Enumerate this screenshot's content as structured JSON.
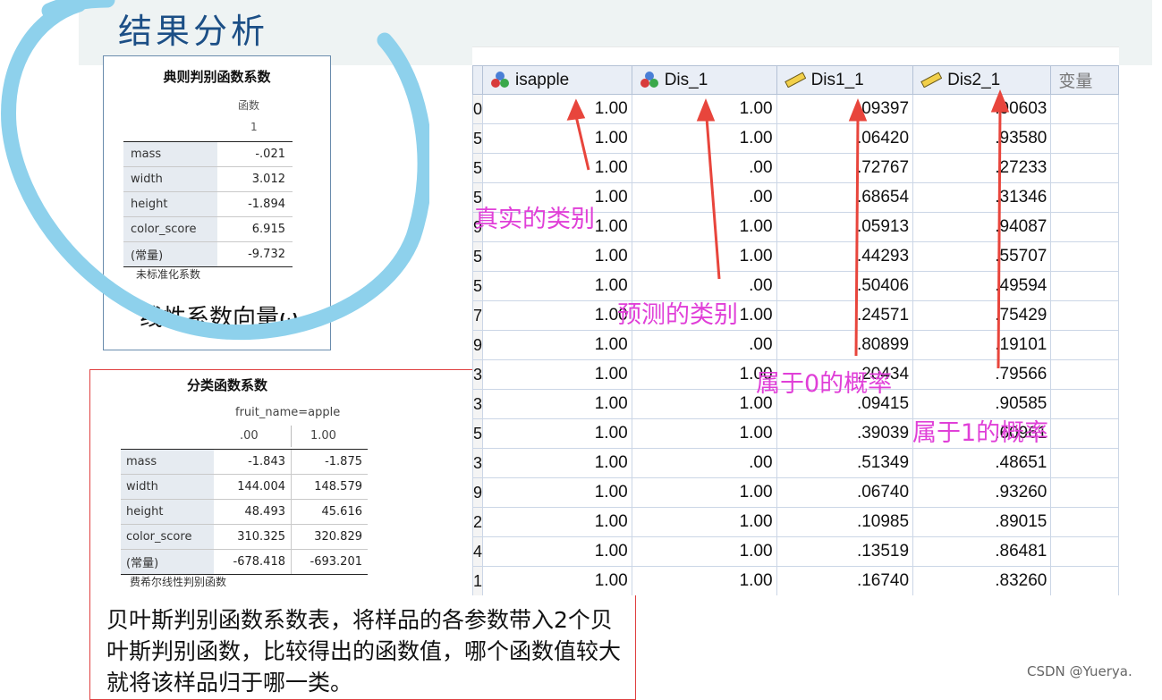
{
  "slide": {
    "title": "结果分析",
    "watermark": "CSDN @Yuerya."
  },
  "canonical": {
    "title": "典则判别函数系数",
    "header1": "函数",
    "header2": "1",
    "rows": [
      {
        "label": "mass",
        "value": "-.021"
      },
      {
        "label": "width",
        "value": "3.012"
      },
      {
        "label": "height",
        "value": "-1.894"
      },
      {
        "label": "color_score",
        "value": "6.915"
      },
      {
        "label": "(常量)",
        "value": "-9.732"
      }
    ],
    "footnote": "未标准化系数",
    "caption": "线性系数向量ω"
  },
  "fisher": {
    "title": "分类函数系数",
    "header1": "fruit_name=apple",
    "col0": ".00",
    "col1": "1.00",
    "rows": [
      {
        "label": "mass",
        "v0": "-1.843",
        "v1": "-1.875"
      },
      {
        "label": "width",
        "v0": "144.004",
        "v1": "148.579"
      },
      {
        "label": "height",
        "v0": "48.493",
        "v1": "45.616"
      },
      {
        "label": "color_score",
        "v0": "310.325",
        "v1": "320.829"
      },
      {
        "label": "(常量)",
        "v0": "-678.418",
        "v1": "-693.201"
      }
    ],
    "footnote": "费希尔线性判别函数",
    "caption": "贝叶斯判别函数系数表，将样品的各参数带入2个贝叶斯判别函数，比较得出的函数值，哪个函数值较大就将该样品归于哪一类。"
  },
  "grid": {
    "columns": [
      "isapple",
      "Dis_1",
      "Dis1_1",
      "Dis2_1",
      "变量"
    ],
    "column_icons": [
      "nominal-icon",
      "nominal-icon",
      "scale-ruler-icon",
      "scale-ruler-icon",
      ""
    ],
    "row_id_fragments": [
      "0",
      "5",
      "5",
      "5",
      "9",
      "5",
      "5",
      "7",
      "9",
      "3",
      "3",
      "5",
      "3",
      "9",
      "2",
      "4",
      "1"
    ],
    "rows": [
      [
        "1.00",
        "1.00",
        ".09397",
        ".90603"
      ],
      [
        "1.00",
        "1.00",
        ".06420",
        ".93580"
      ],
      [
        "1.00",
        ".00",
        ".72767",
        ".27233"
      ],
      [
        "1.00",
        ".00",
        ".68654",
        ".31346"
      ],
      [
        "1.00",
        "1.00",
        ".05913",
        ".94087"
      ],
      [
        "1.00",
        "1.00",
        ".44293",
        ".55707"
      ],
      [
        "1.00",
        ".00",
        ".50406",
        ".49594"
      ],
      [
        "1.00",
        "1.00",
        ".24571",
        ".75429"
      ],
      [
        "1.00",
        ".00",
        ".80899",
        ".19101"
      ],
      [
        "1.00",
        "1.00",
        ".20434",
        ".79566"
      ],
      [
        "1.00",
        "1.00",
        ".09415",
        ".90585"
      ],
      [
        "1.00",
        "1.00",
        ".39039",
        ".60961"
      ],
      [
        "1.00",
        ".00",
        ".51349",
        ".48651"
      ],
      [
        "1.00",
        "1.00",
        ".06740",
        ".93260"
      ],
      [
        "1.00",
        "1.00",
        ".10985",
        ".89015"
      ],
      [
        "1.00",
        "1.00",
        ".13519",
        ".86481"
      ],
      [
        "1.00",
        "1.00",
        ".16740",
        ".83260"
      ]
    ]
  },
  "annotations": {
    "true_class": "真实的类别",
    "predicted_class": "预测的类别",
    "prob0": "属于0的概率",
    "prob1": "属于1的概率"
  },
  "colors": {
    "title": "#1c4f86",
    "annotation": "#e040d8",
    "arrow": "#e8453c",
    "circle": "#8ed1ec",
    "panel_border_red": "#e04040"
  }
}
